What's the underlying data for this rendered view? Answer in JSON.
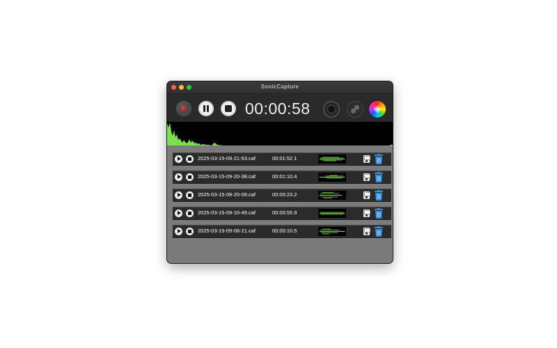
{
  "window": {
    "title": "SonicCapture"
  },
  "timer": {
    "elapsed": "00:00:58"
  },
  "colors": {
    "waveform_green": "#7be04a",
    "trash_blue": "#2f8fe0",
    "record_red": "#c02020"
  },
  "recordings": [
    {
      "name": "2025-03-15-09-21-53.caf",
      "duration": "00:01:52.1"
    },
    {
      "name": "2025-03-15-09-20-38.caf",
      "duration": "00:01:10.4"
    },
    {
      "name": "2025-03-15-09-20-09.caf",
      "duration": "00:00:23.2"
    },
    {
      "name": "2025-03-15-09-10-49.caf",
      "duration": "00:00:55.9"
    },
    {
      "name": "2025-03-15-09-06-21.caf",
      "duration": "00:00:10.5"
    }
  ]
}
